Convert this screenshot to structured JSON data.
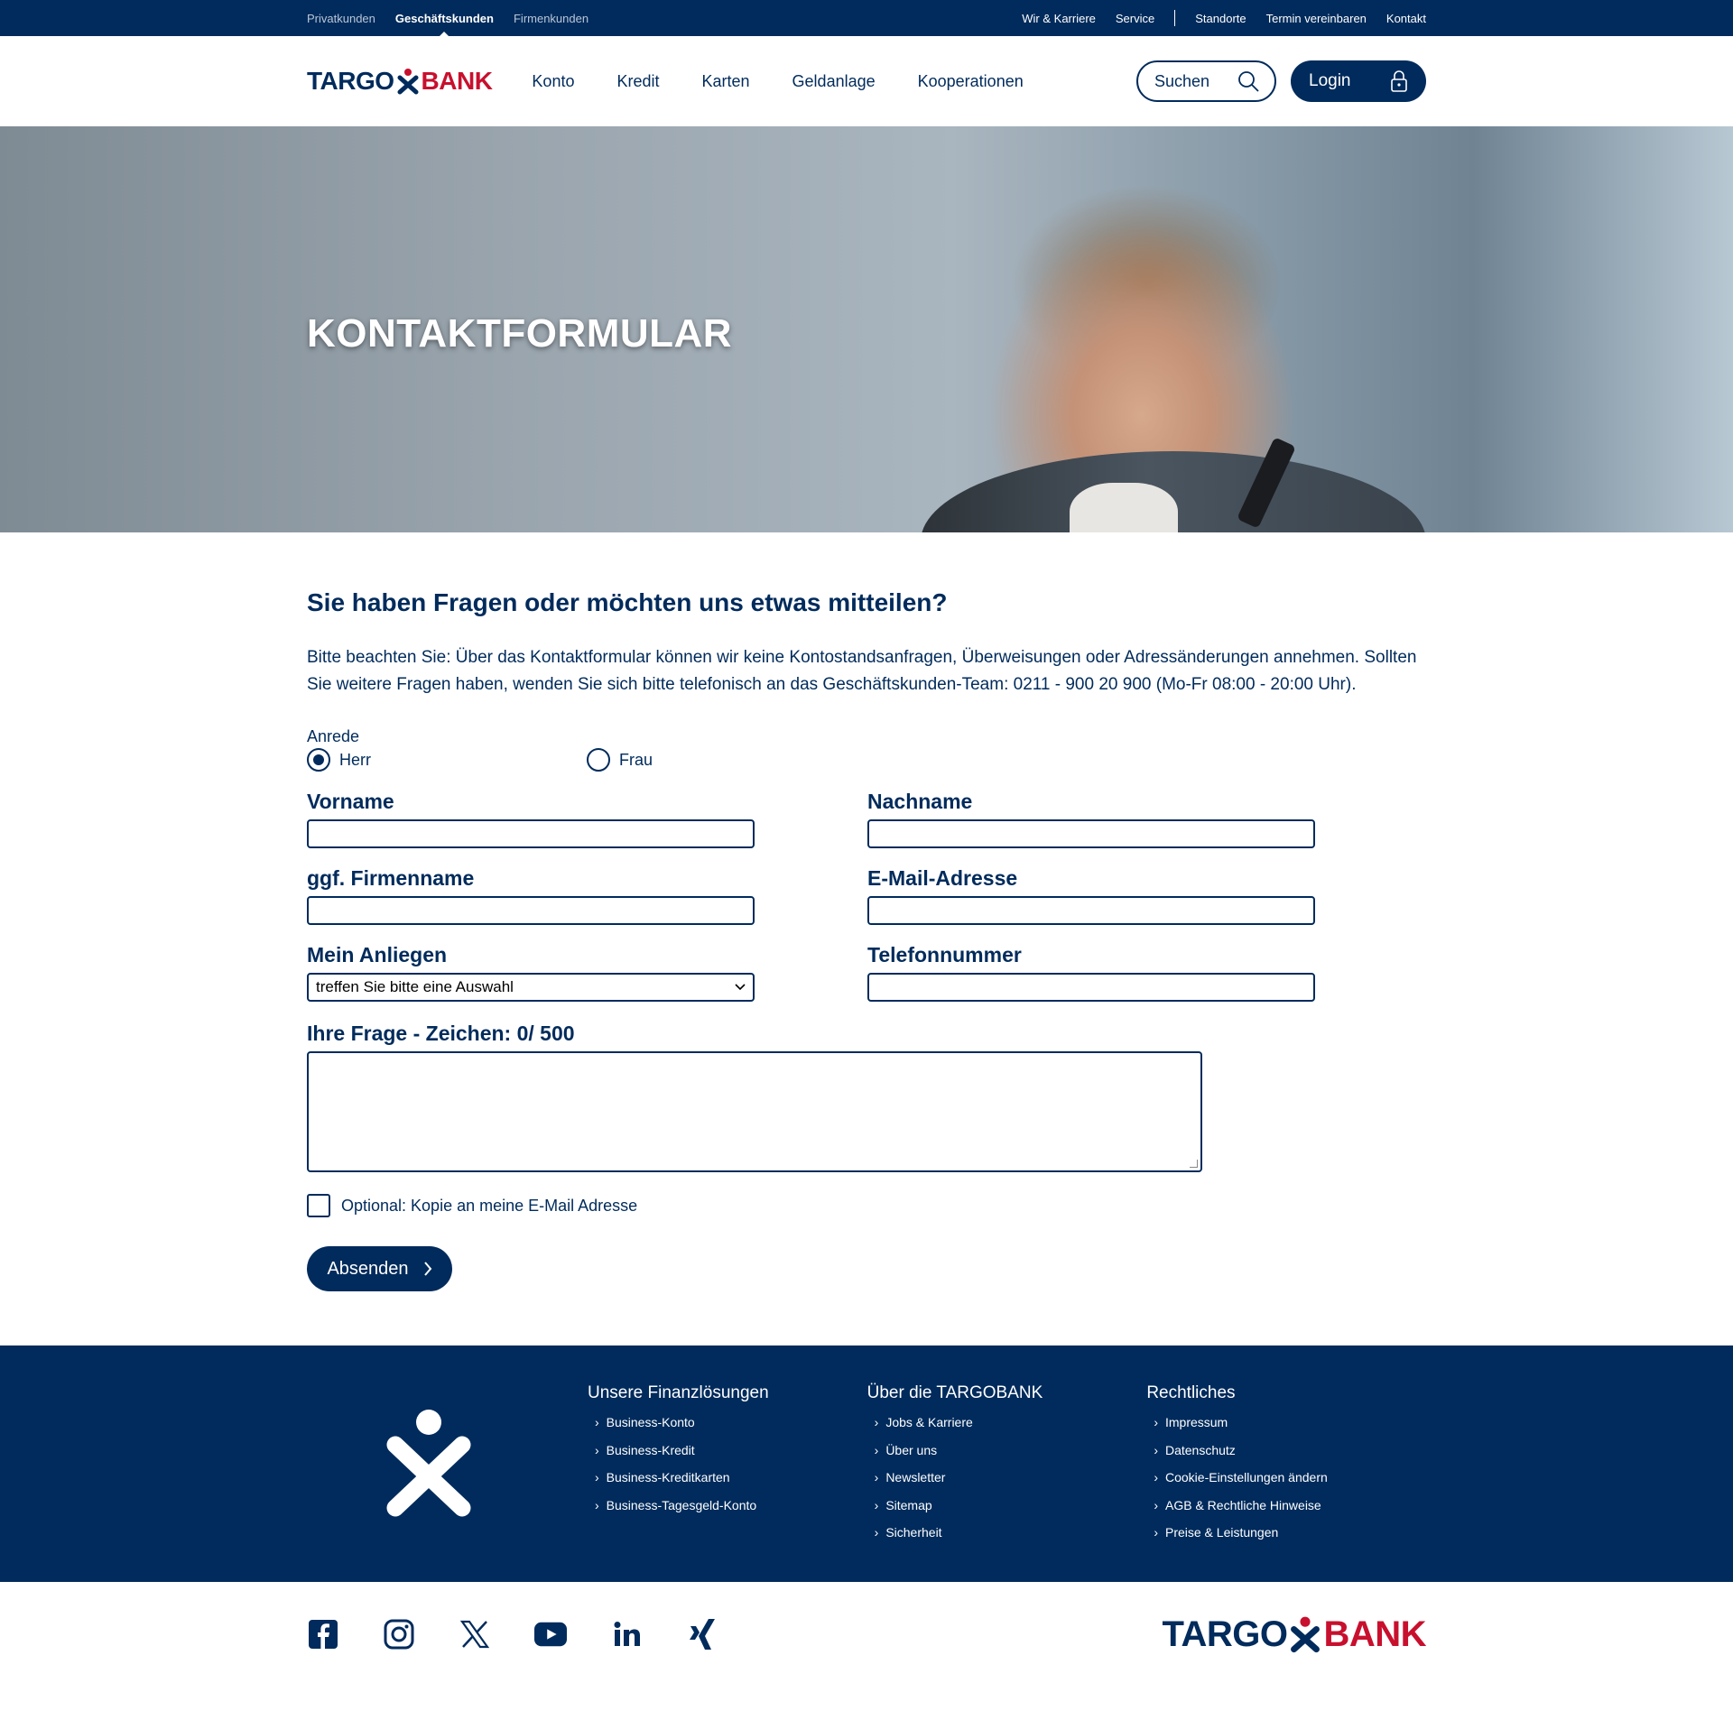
{
  "topbar": {
    "segments": [
      "Privatkunden",
      "Geschäftskunden",
      "Firmenkunden"
    ],
    "links": [
      "Wir & Karriere",
      "Service",
      "Standorte",
      "Termin vereinbaren",
      "Kontakt"
    ]
  },
  "header": {
    "logo_left": "TARGO",
    "logo_right": "BANK",
    "nav": [
      "Konto",
      "Kredit",
      "Karten",
      "Geldanlage",
      "Kooperationen"
    ],
    "search_label": "Suchen",
    "login_label": "Login"
  },
  "hero": {
    "title": "KONTAKTFORMULAR"
  },
  "content": {
    "heading": "Sie haben Fragen oder möchten uns etwas mitteilen?",
    "intro": "Bitte beachten Sie: Über das Kontaktformular können wir keine Kontostandsanfragen, Überweisungen oder Adressänderungen annehmen. Sollten Sie weitere Fragen haben, wenden Sie sich bitte telefonisch an das Geschäftskunden-Team: 0211 - 900 20 900 (Mo-Fr 08:00 - 20:00 Uhr).",
    "anrede_label": "Anrede",
    "anrede_options": [
      "Herr",
      "Frau"
    ],
    "anrede_selected": "Herr",
    "fields": {
      "vorname": "Vorname",
      "nachname": "Nachname",
      "firma": "ggf. Firmenname",
      "email": "E-Mail-Adresse",
      "anliegen": "Mein Anliegen",
      "telefon": "Telefonnummer"
    },
    "anliegen_selected": "treffen Sie bitte eine Auswahl",
    "frage_label": "Ihre Frage - Zeichen: 0/ 500",
    "copy_label": "Optional: Kopie an meine E-Mail Adresse",
    "submit_label": "Absenden"
  },
  "footer": {
    "columns": [
      {
        "title": "Unsere Finanzlösungen",
        "links": [
          "Business-Konto",
          "Business-Kredit",
          "Business-Kreditkarten",
          "Business-Tagesgeld-Konto"
        ]
      },
      {
        "title": "Über die TARGOBANK",
        "links": [
          "Jobs & Karriere",
          "Über uns",
          "Newsletter",
          "Sitemap",
          "Sicherheit"
        ]
      },
      {
        "title": "Rechtliches",
        "links": [
          "Impressum",
          "Datenschutz",
          "Cookie-Einstellungen ändern",
          "AGB & Rechtliche Hinweise",
          "Preise & Leistungen"
        ]
      }
    ],
    "social_icons": [
      "facebook-icon",
      "instagram-icon",
      "x-icon",
      "youtube-icon",
      "linkedin-icon",
      "xing-icon"
    ]
  },
  "colors": {
    "brand_blue": "#002b5c",
    "brand_red": "#c8102e"
  }
}
